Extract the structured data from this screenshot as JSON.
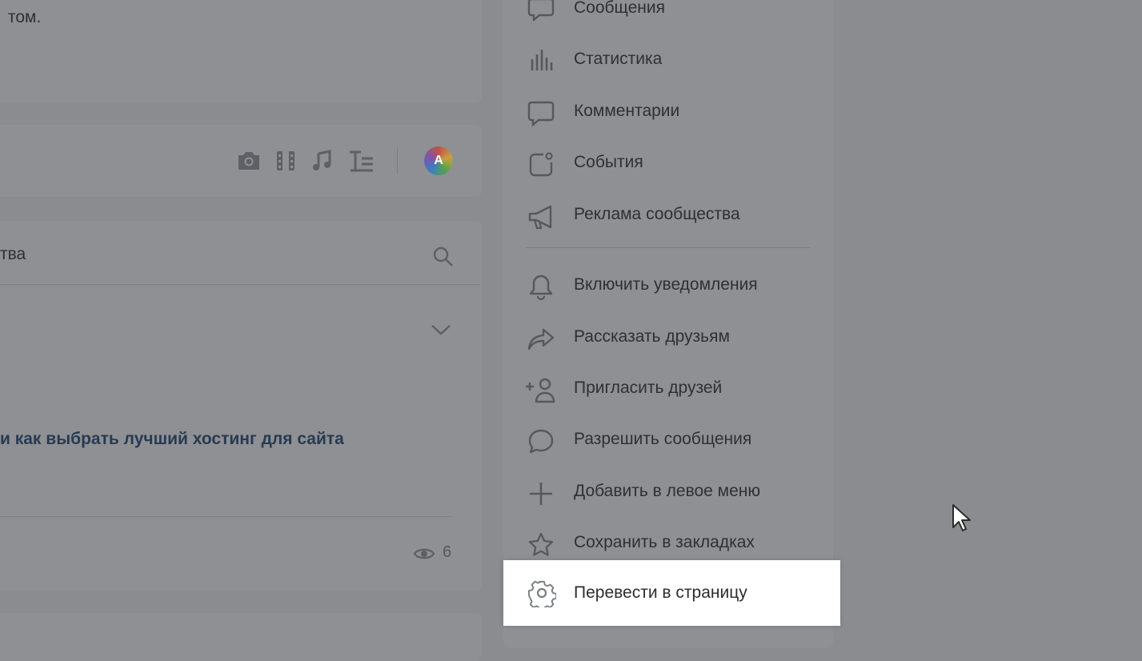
{
  "post": {
    "text_fragment": "том."
  },
  "composer": {
    "avatar_letter": "A",
    "icons": [
      "camera-icon",
      "video-icon",
      "music-icon",
      "text-format-icon"
    ]
  },
  "feed": {
    "search_fragment": "тва",
    "post_title": "и как выбрать лучший хостинг для сайта",
    "views_count": "6"
  },
  "menu": {
    "items_top": [
      {
        "label": "Сообщения",
        "icon": "message-icon"
      },
      {
        "label": "Статистика",
        "icon": "statistics-icon"
      },
      {
        "label": "Комментарии",
        "icon": "comments-icon"
      },
      {
        "label": "События",
        "icon": "events-icon"
      },
      {
        "label": "Реклама сообщества",
        "icon": "megaphone-icon"
      }
    ],
    "items_bottom": [
      {
        "label": "Включить уведомления",
        "icon": "bell-icon"
      },
      {
        "label": "Рассказать друзьям",
        "icon": "share-icon"
      },
      {
        "label": "Пригласить друзей",
        "icon": "invite-user-icon"
      },
      {
        "label": "Разрешить сообщения",
        "icon": "chat-bubble-icon"
      },
      {
        "label": "Добавить в левое меню",
        "icon": "plus-icon"
      },
      {
        "label": "Сохранить в закладках",
        "icon": "star-icon"
      }
    ],
    "highlighted": {
      "label": "Перевести в страницу",
      "icon": "gear-icon"
    }
  },
  "colors": {
    "overlay_background": "#8a8c8f",
    "highlight_background": "#ffffff",
    "link_title": "#283a52"
  }
}
